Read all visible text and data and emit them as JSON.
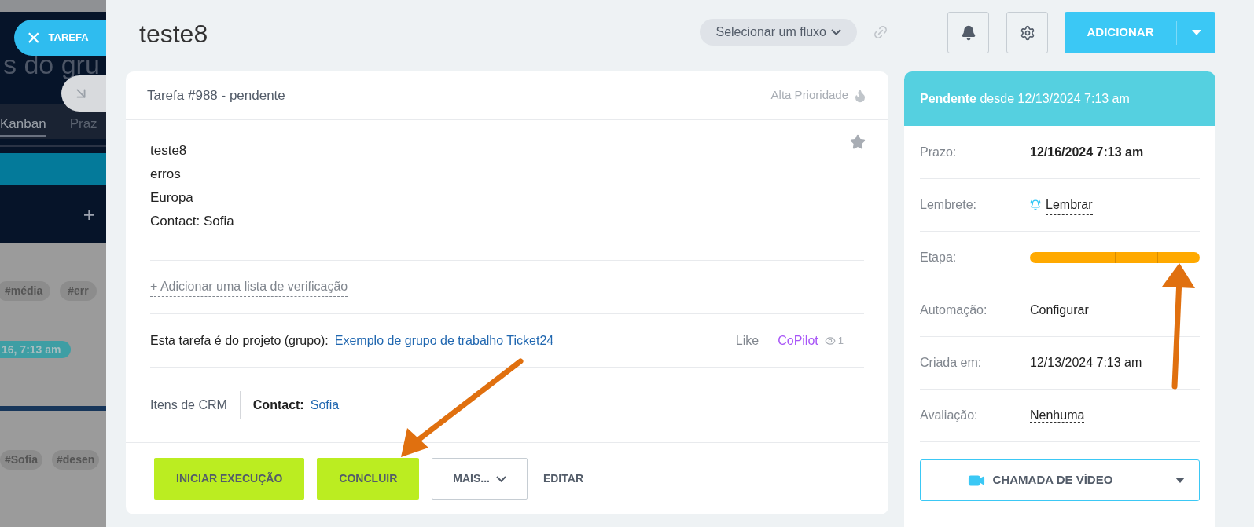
{
  "background": {
    "heading": "s do gru",
    "tabs": [
      {
        "label": "Kanban",
        "selected": true
      },
      {
        "label": "Praz",
        "selected": false
      }
    ],
    "plus": "+",
    "tags_1": [
      "#média",
      "#err"
    ],
    "date_pill": "16, 7:13 am",
    "tags_2": [
      "#Sofia",
      "#desen"
    ]
  },
  "close_button": {
    "icon": "×",
    "label": "TAREFA"
  },
  "task_title": "teste8",
  "flow_select": {
    "label": "Selecionar um fluxo"
  },
  "add_button": {
    "label": "ADICIONAR"
  },
  "task_card": {
    "header": "Tarefa #988 - pendente",
    "priority": "Alta Prioridade",
    "starred": false,
    "description": [
      "teste8",
      "erros",
      "Europa",
      "Contact: Sofia"
    ],
    "checklist_link": "+ Adicionar uma lista de verificação",
    "project_label": "Esta tarefa é do projeto (grupo):",
    "project_link": "Exemplo de grupo de trabalho Ticket24",
    "like": "Like",
    "copilot": "CoPilot",
    "views": "1",
    "crm_label": "Itens de CRM",
    "crm_contact_label": "Contact:",
    "crm_contact": "Sofia",
    "buttons": [
      {
        "label": "INICIAR EXECUÇÃO",
        "kind": "primary"
      },
      {
        "label": "CONCLUIR",
        "kind": "primary"
      },
      {
        "label": "MAIS...",
        "kind": "dropdown"
      },
      {
        "label": "EDITAR",
        "kind": "link"
      }
    ]
  },
  "status_panel": {
    "status": "Pendente",
    "since": "desde 12/13/2024 7:13 am",
    "fields": [
      {
        "label": "Prazo:",
        "value": "12/16/2024 7:13 am",
        "kind": "deadline"
      },
      {
        "label": "Lembrete:",
        "value": "Lembrar",
        "kind": "reminder"
      },
      {
        "label": "Etapa:",
        "kind": "stages",
        "segments": [
          {
            "done": true
          },
          {
            "done": true
          },
          {
            "done": true
          },
          {
            "done": true
          }
        ]
      },
      {
        "label": "Automação:",
        "value": "Configurar",
        "kind": "link"
      },
      {
        "label": "Criada em:",
        "value": "12/13/2024 7:13 am",
        "kind": "text"
      },
      {
        "label": "Avaliação:",
        "value": "Nenhuma",
        "kind": "link"
      }
    ],
    "video_button": {
      "label": "CHAMADA DE VÍDEO"
    }
  }
}
